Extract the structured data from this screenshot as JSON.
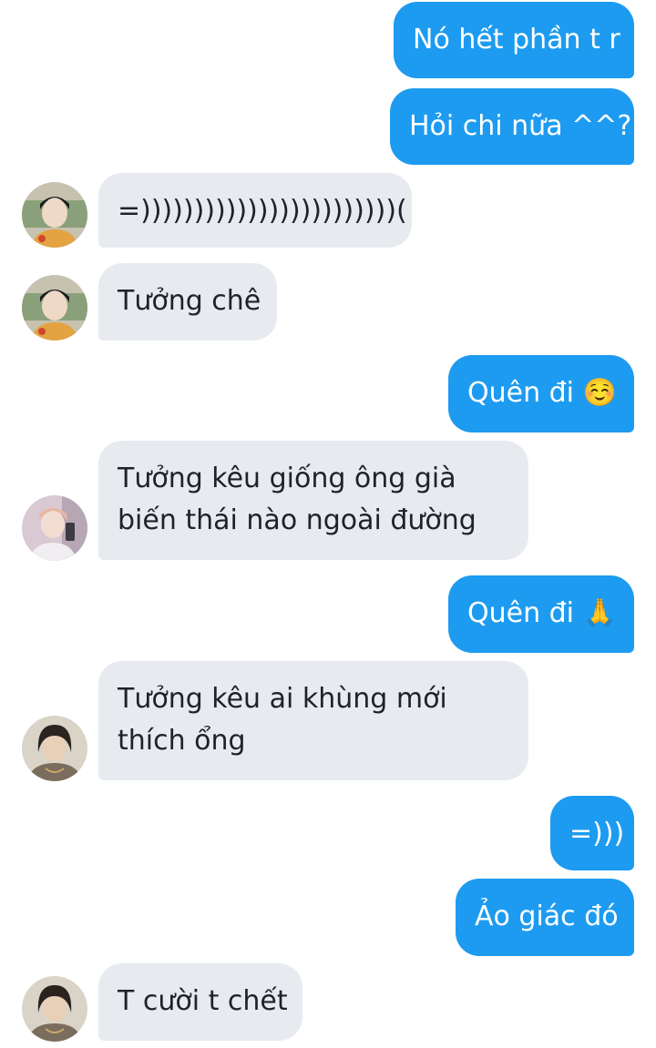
{
  "conversation": {
    "messages": [
      {
        "side": "outgoing",
        "text": "Nó hết phần t r"
      },
      {
        "side": "outgoing",
        "text": "Hỏi chi nữa ^^?"
      },
      {
        "side": "incoming",
        "text": "=))))))))))))))))))))))))(",
        "avatar": "avatar-1"
      },
      {
        "side": "incoming",
        "text": "Tưởng chê",
        "avatar": "avatar-1"
      },
      {
        "side": "outgoing",
        "text": "Quên đi ☺️"
      },
      {
        "side": "incoming",
        "text_lines": [
          "Tưởng kêu giống ông già",
          "biến thái nào ngoài đường"
        ],
        "avatar": "avatar-2"
      },
      {
        "side": "outgoing",
        "text": "Quên đi 🙏"
      },
      {
        "side": "incoming",
        "text_lines": [
          "Tưởng kêu ai khùng mới",
          "thích ổng"
        ],
        "avatar": "avatar-3"
      },
      {
        "side": "outgoing",
        "text": "=)))"
      },
      {
        "side": "outgoing",
        "text": "Ảo giác đó"
      },
      {
        "side": "incoming",
        "text": "T cười t chết",
        "avatar": "avatar-3"
      }
    ]
  },
  "colors": {
    "outgoing_bubble": "#1d9bf0",
    "incoming_bubble": "#e7ebef",
    "outgoing_text": "#ffffff",
    "incoming_text": "#1f2328",
    "background": "#ffffff"
  }
}
